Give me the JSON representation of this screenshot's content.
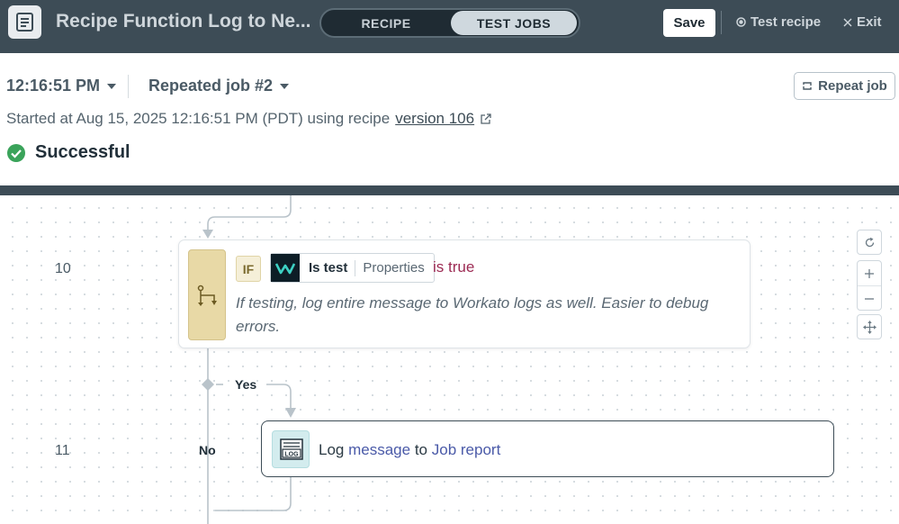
{
  "topbar": {
    "title": "Recipe Function Log to Ne...",
    "tabs": [
      {
        "label": "RECIPE",
        "active": false
      },
      {
        "label": "TEST JOBS",
        "active": true
      }
    ],
    "save_label": "Save",
    "test_recipe_label": "Test recipe",
    "exit_label": "Exit"
  },
  "job": {
    "time": "12:16:51 PM",
    "job_label": "Repeated job #2",
    "repeat_label": "Repeat job",
    "started_text": "Started at Aug 15, 2025 12:16:51 PM (PDT) using recipe",
    "version_link": "version 106",
    "status": "Successful"
  },
  "steps": [
    {
      "number": "10",
      "badge": "IF",
      "field": "Is test",
      "field_source": "Properties",
      "condition": "is true",
      "description": "If testing, log entire message to Workato logs as well. Easier to debug errors."
    },
    {
      "number": "11",
      "action_prefix": "Log",
      "action_pill1": "message",
      "action_mid": "to",
      "action_pill2": "Job report",
      "icon_text": "LOG"
    }
  ],
  "branches": {
    "yes": "Yes",
    "no": "No"
  },
  "colors": {
    "topbar": "#3d4c56",
    "success": "#3aa35a",
    "condition": "#9c2a53",
    "link": "#4a5aa8"
  }
}
